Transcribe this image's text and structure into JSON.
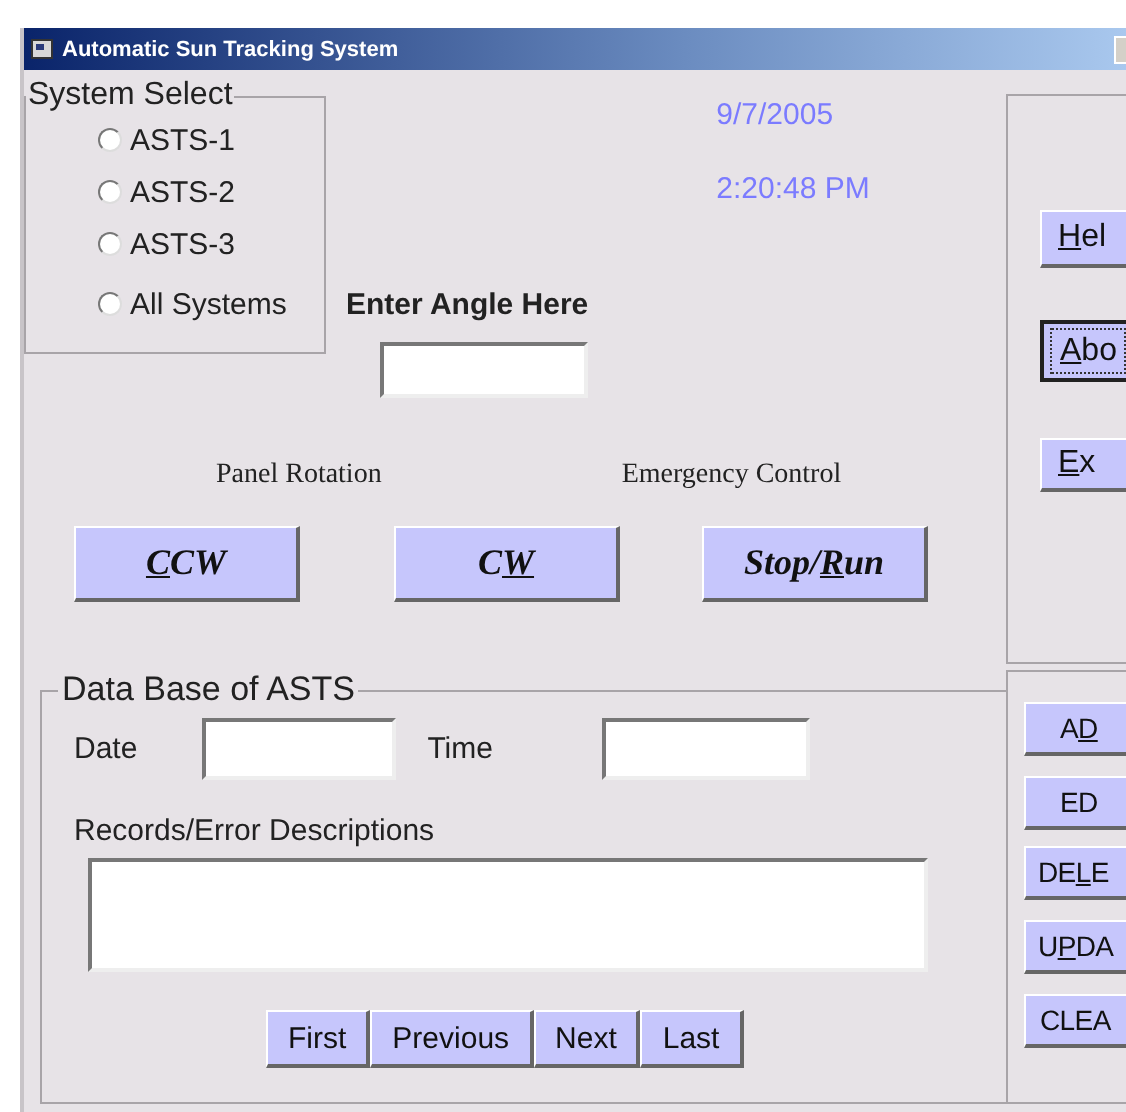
{
  "window": {
    "title": "Automatic Sun Tracking System"
  },
  "system_select": {
    "label": "System Select",
    "options": [
      {
        "label": "ASTS-1",
        "selected": false
      },
      {
        "label": "ASTS-2",
        "selected": false
      },
      {
        "label": "ASTS-3",
        "selected": false
      },
      {
        "label": "All Systems",
        "selected": false
      }
    ]
  },
  "date": "9/7/2005",
  "time": "2:20:48 PM",
  "angle": {
    "label": "Enter Angle Here"
  },
  "panel_rotation": {
    "label": "Panel Rotation",
    "buttons": [
      {
        "key": "C",
        "post": "CW"
      },
      {
        "pre": "C",
        "key": "W"
      }
    ]
  },
  "emergency": {
    "label": "Emergency Control",
    "button": {
      "pre": "Stop/",
      "key": "R",
      "post": "un"
    }
  },
  "side_buttons": [
    {
      "key": "H",
      "post": "el",
      "focused": false
    },
    {
      "key": "A",
      "post": "bo",
      "focused": true
    },
    {
      "key": "E",
      "post": "x",
      "focused": false
    }
  ],
  "database": {
    "title": "Data Base of ASTS",
    "date_label": "Date",
    "time_label": "Time",
    "records_label": "Records/Error Descriptions",
    "nav_buttons": [
      "First",
      "Previous",
      "Next",
      "Last"
    ]
  },
  "record_buttons": [
    {
      "pre": "A",
      "key": "D"
    },
    {
      "pre": "ED"
    },
    {
      "pre": "DE",
      "key": "L",
      "post": "E"
    },
    {
      "pre": "U",
      "key": "P",
      "post": "DA"
    },
    {
      "pre": "CLEA"
    }
  ]
}
